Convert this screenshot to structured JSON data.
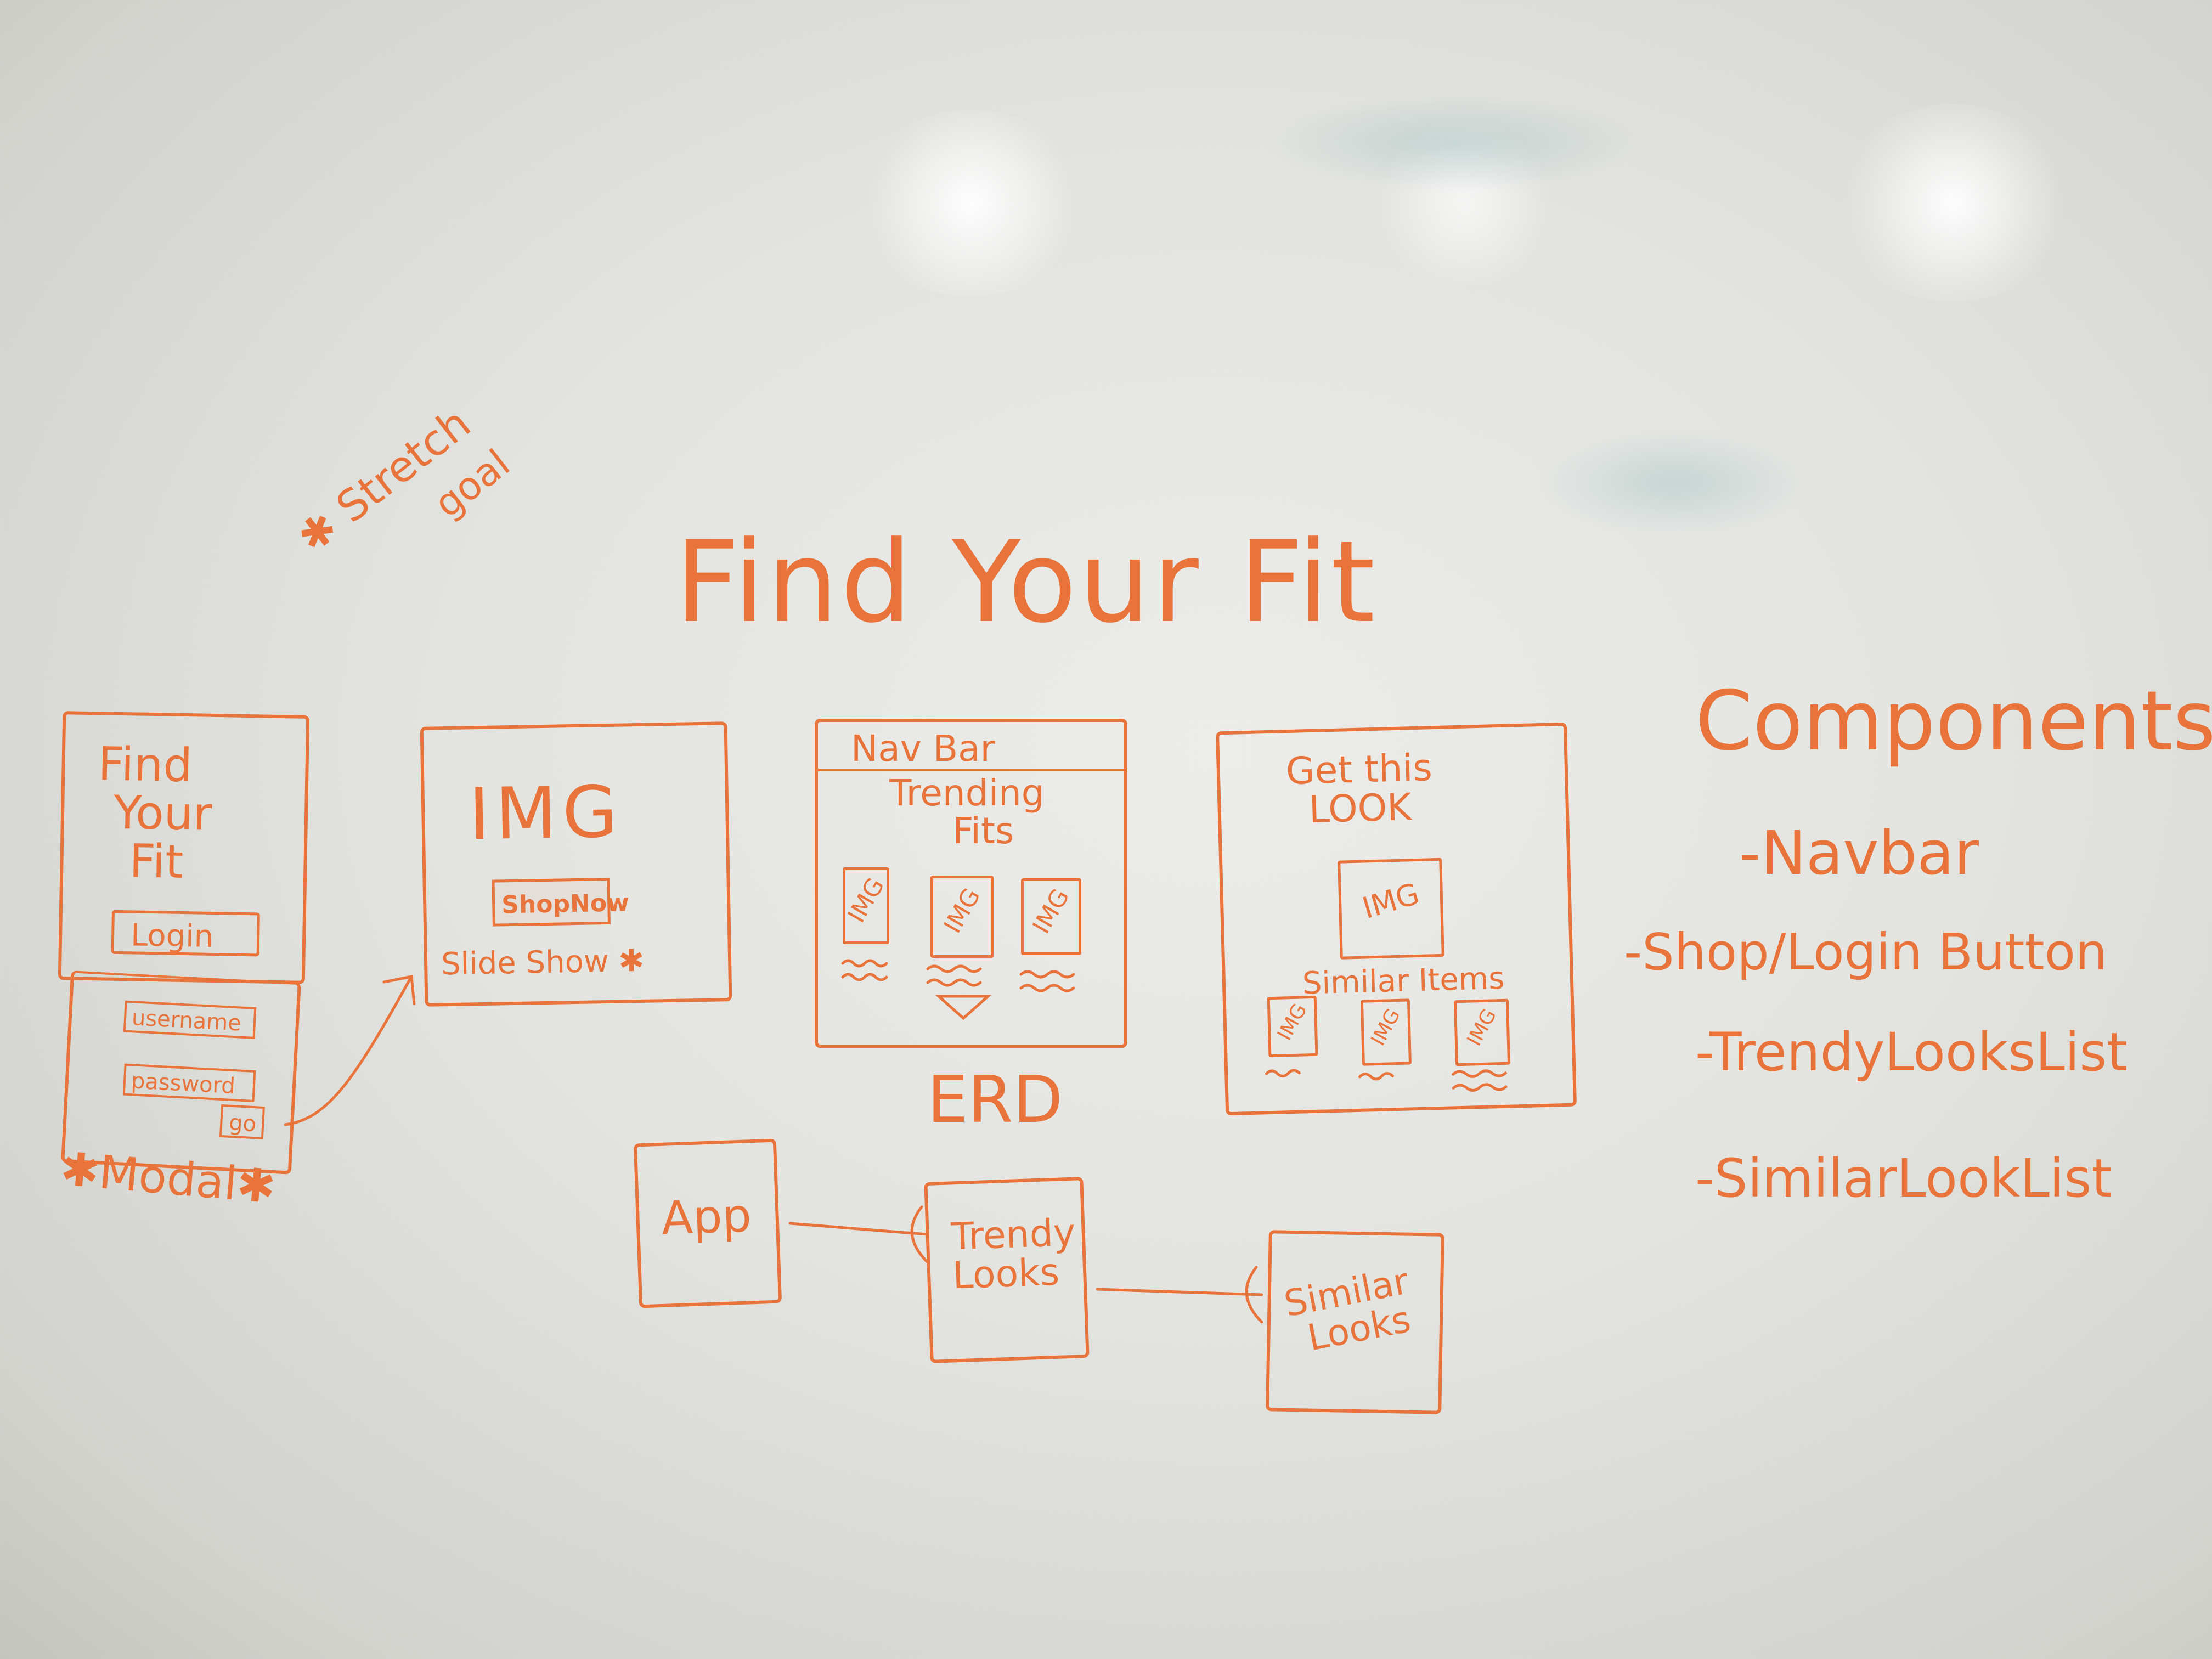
{
  "stretch_note": {
    "line1": "✱ Stretch",
    "line2": "goal"
  },
  "title": "Find Your Fit",
  "wireframes": {
    "landing": {
      "heading_lines": [
        "Find",
        "Your",
        "Fit"
      ],
      "login_button": "Login"
    },
    "modal": {
      "username_field": "username",
      "password_field": "password",
      "go_button": "go",
      "caption": "✱Modal✱"
    },
    "slideshow": {
      "img_label": "IMG",
      "shop_button": "ShopNow",
      "caption": "Slide Show ✱"
    },
    "trending": {
      "navbar_label": "Nav Bar",
      "heading_lines": [
        "Trending",
        "Fits"
      ],
      "image_labels": [
        "IMG",
        "IMG",
        "IMG"
      ]
    },
    "look": {
      "heading_lines": [
        "Get this",
        "LOOK"
      ],
      "main_image": "IMG",
      "similar_label": "Similar Items",
      "image_labels": [
        "IMG",
        "IMG",
        "IMG"
      ]
    }
  },
  "erd": {
    "label": "ERD",
    "app": "App",
    "trendy_lines": [
      "Trendy",
      "Looks"
    ],
    "similar_lines": [
      "Similar",
      "Looks"
    ]
  },
  "components": {
    "heading": "Components",
    "items": [
      "-Navbar",
      "-Shop/Login Button",
      "-TrendyLooksList",
      "-SimilarLookList"
    ]
  },
  "colors": {
    "ink": "#e8743b",
    "board": "#e6e7e3"
  }
}
